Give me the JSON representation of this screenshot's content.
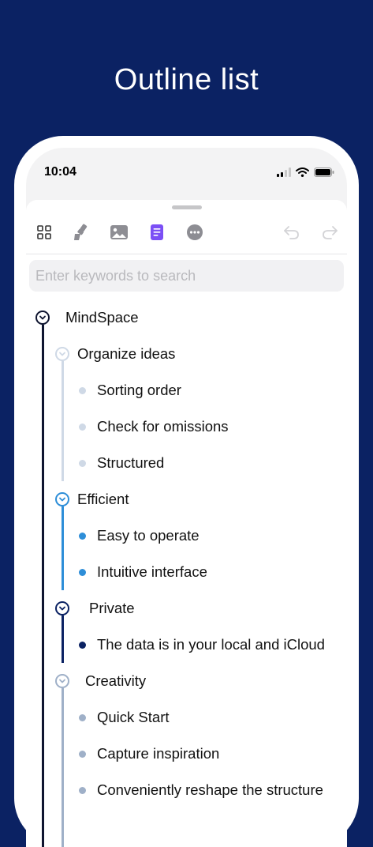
{
  "hero": {
    "title": "Outline list"
  },
  "status_bar": {
    "time": "10:04"
  },
  "toolbar": {
    "items": [
      {
        "icon": "grid-icon"
      },
      {
        "icon": "brush-icon"
      },
      {
        "icon": "image-icon"
      },
      {
        "icon": "outline-document-icon",
        "active": true
      },
      {
        "icon": "more-icon"
      },
      {
        "icon": "undo-icon"
      },
      {
        "icon": "redo-icon"
      }
    ],
    "accent_color": "#7b4ff5"
  },
  "search": {
    "placeholder": "Enter keywords to search",
    "value": ""
  },
  "outline": {
    "root": {
      "label": "MindSpace",
      "color": "#0f1530"
    },
    "groups": [
      {
        "label": "Organize ideas",
        "color": "#cfd9e6",
        "items": [
          "Sorting order",
          "Check for omissions",
          "Structured"
        ]
      },
      {
        "label": "Efficient",
        "color": "#2e8ed8",
        "items": [
          "Easy to operate",
          "Intuitive interface"
        ]
      },
      {
        "label": "Private",
        "color": "#0b2263",
        "items": [
          "The data is in your local and iCloud"
        ]
      },
      {
        "label": "Creativity",
        "color": "#9fb0c8",
        "items": [
          "Quick Start",
          "Capture inspiration",
          "Conveniently reshape the structure"
        ]
      }
    ]
  }
}
